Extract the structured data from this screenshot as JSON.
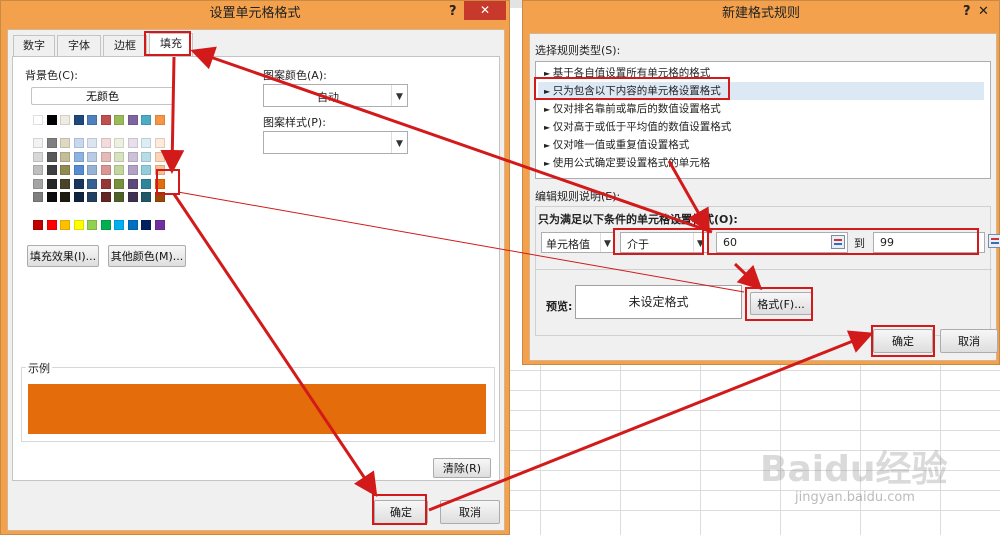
{
  "format_cells": {
    "title": "设置单元格格式",
    "help": "?",
    "close": "✕",
    "tabs": [
      "数字",
      "字体",
      "边框",
      "填充"
    ],
    "bg_color_label": "背景色(C):",
    "no_color_label": "无颜色",
    "pattern_color_label": "图案颜色(A):",
    "pattern_color_value": "自动",
    "pattern_style_label": "图案样式(P):",
    "fill_effects_button": "填充效果(I)...",
    "more_colors_button": "其他颜色(M)...",
    "sample_label": "示例",
    "sample_color": "#e46c0a",
    "clear_button": "清除(R)",
    "ok_button": "确定",
    "cancel_button": "取消"
  },
  "new_rule": {
    "title": "新建格式规则",
    "help": "?",
    "close": "✕",
    "select_type_label": "选择规则类型(S):",
    "rule_types": [
      "基于各自值设置所有单元格的格式",
      "只为包含以下内容的单元格设置格式",
      "仅对排名靠前或靠后的数值设置格式",
      "仅对高于或低于平均值的数值设置格式",
      "仅对唯一值或重复值设置格式",
      "使用公式确定要设置格式的单元格"
    ],
    "edit_label": "编辑规则说明(E):",
    "condition_heading": "只为满足以下条件的单元格设置格式(O):",
    "cell_value_option": "单元格值",
    "operator_option": "介于",
    "value_from": "60",
    "to_label": "到",
    "value_to": "99",
    "preview_label": "预览:",
    "preview_text": "未设定格式",
    "format_button": "格式(F)...",
    "ok_button": "确定",
    "cancel_button": "取消"
  },
  "bg_app": {
    "ribbon_fragment": "清除"
  },
  "watermark": {
    "brand": "Baidu经验",
    "url": "jingyan.baidu.com"
  },
  "colors": {
    "highlight_red": "#d21a1a",
    "selected_fill": "#e46c0a",
    "window_frame": "#f3a14c"
  }
}
